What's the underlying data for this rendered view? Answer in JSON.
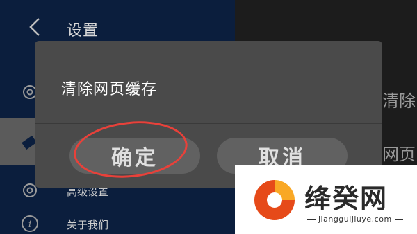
{
  "header": {
    "title": "设置"
  },
  "settings_rows": [
    {
      "label": "",
      "icon": "gear-icon"
    },
    {
      "label": "",
      "icon": "clear-cache-icon"
    },
    {
      "label": "高级设置",
      "icon": "gear-icon"
    },
    {
      "label": "关于我们",
      "icon": "info-icon"
    }
  ],
  "background_right": {
    "line1": "清除",
    "line2": "网页"
  },
  "dialog": {
    "title": "清除网页缓存",
    "confirm_label": "确定",
    "cancel_label": "取消"
  },
  "watermark": {
    "name": "绛癸网",
    "url": "jiangguijiuye.com"
  },
  "colors": {
    "annotation": "#e8413a",
    "dialog_bg": "#4a4a4a",
    "button_bg": "#616161"
  }
}
